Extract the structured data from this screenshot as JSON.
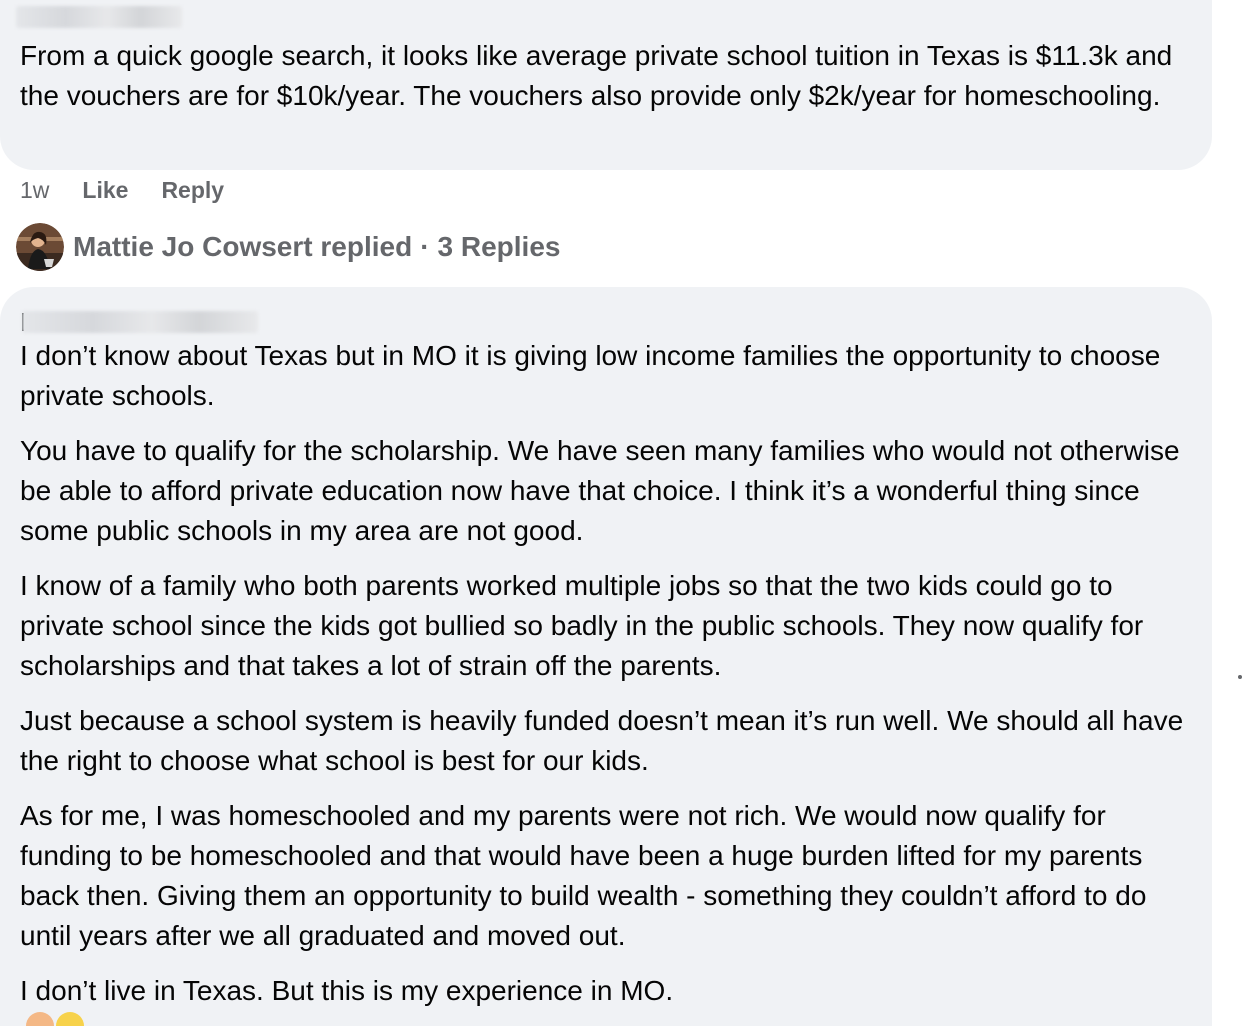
{
  "comment_1": {
    "text": "From a quick google search, it looks like average private school tuition in Texas is $11.3k and the vouchers are for $10k/year. The vouchers also provide only $2k/year for homeschooling.",
    "time": "1w",
    "like_label": "Like",
    "reply_label": "Reply"
  },
  "replies_summary": {
    "author": "Mattie Jo Cowsert replied",
    "separator": "·",
    "count_label": "3 Replies"
  },
  "comment_2": {
    "paragraphs": [
      "I don’t know about Texas but in MO it is giving low income families the opportunity to choose private schools.",
      "You have to qualify for the scholarship. We have seen many families who would not otherwise be able to afford private education now have that choice. I think it’s a wonderful thing since some public schools in my area are not good.",
      "I know of a family who both parents worked multiple jobs so that the two kids could go to private school since the kids got bullied so badly in the public schools. They now qualify for scholarships and that takes a lot of strain off the parents.",
      "Just because a school system is heavily funded doesn’t mean it’s run well. We should all have the right to choose what school is best for our kids.",
      "As for me, I was homeschooled and my parents were not rich. We would now qualify for funding to be homeschooled and that would have been a huge burden lifted for my parents back then. Giving them an opportunity to build wealth - something they couldn’t afford to do until years after we all graduated and moved out.",
      "I don’t live in Texas. But this is my experience in MO."
    ]
  },
  "colors": {
    "bubble_bg": "#f0f2f5",
    "text": "#050505",
    "secondary_text": "#65676b"
  },
  "icons": {
    "avatar": "avatar",
    "reactions": [
      "folded-hands-emoji",
      "yellow-heart-emoji"
    ]
  }
}
